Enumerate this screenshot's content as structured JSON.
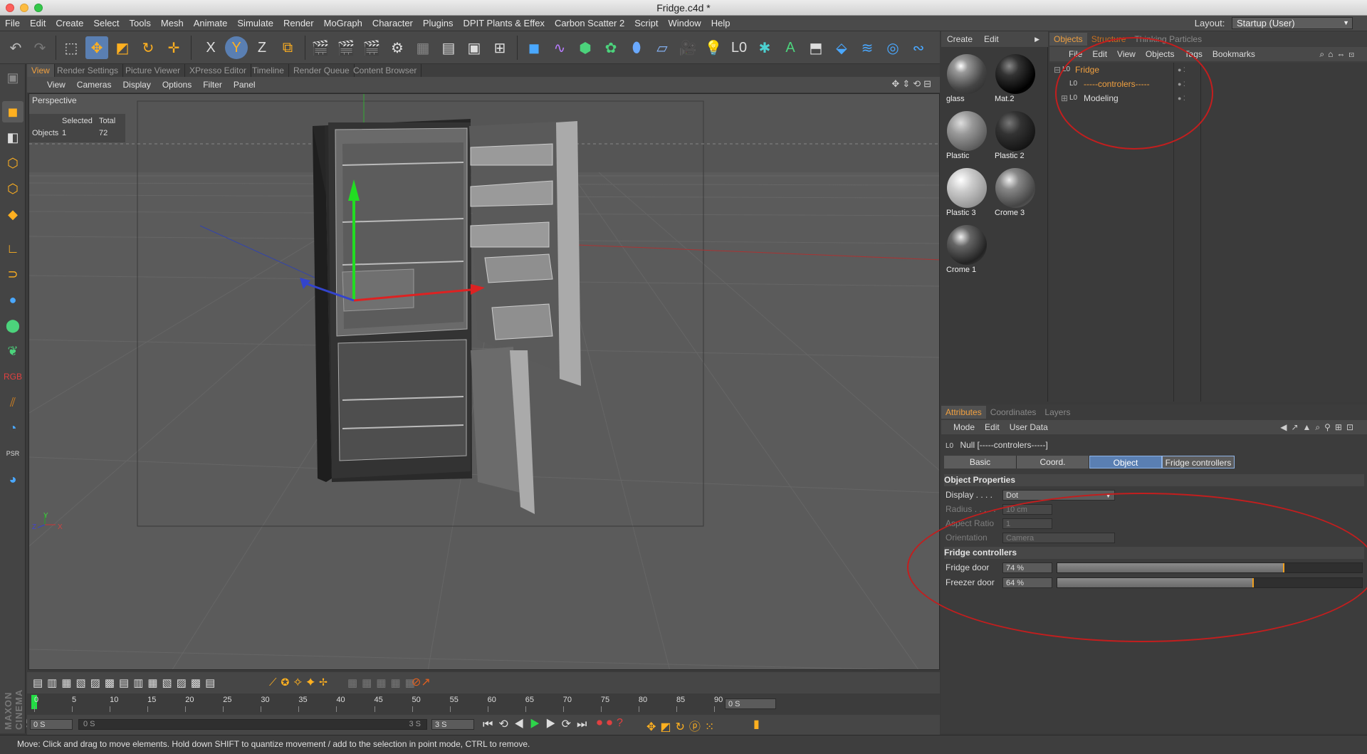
{
  "window": {
    "title": "Fridge.c4d *"
  },
  "menubar": {
    "items": [
      "File",
      "Edit",
      "Create",
      "Select",
      "Tools",
      "Mesh",
      "Animate",
      "Simulate",
      "Render",
      "MoGraph",
      "Character",
      "Plugins",
      "DPIT Plants & Effex",
      "Carbon Scatter 2",
      "Script",
      "Window",
      "Help"
    ],
    "layout_label": "Layout:",
    "layout_value": "Startup (User)"
  },
  "viewport_tabs": [
    "View",
    "Render Settings",
    "Picture Viewer",
    "XPresso Editor",
    "Timeline",
    "Render Queue",
    "Content Browser"
  ],
  "viewport_menu": [
    "View",
    "Cameras",
    "Display",
    "Options",
    "Filter",
    "Panel"
  ],
  "viewport": {
    "camera_label": "Perspective",
    "hud": {
      "col_selected": "Selected",
      "col_total": "Total",
      "row_label": "Objects",
      "selected": "1",
      "total": "72"
    },
    "axis": {
      "y": "Y",
      "z": "Z",
      "x": "X"
    }
  },
  "timeline": {
    "ticks": [
      "0",
      "5",
      "10",
      "15",
      "20",
      "25",
      "30",
      "35",
      "40",
      "45",
      "50",
      "55",
      "60",
      "65",
      "70",
      "75",
      "80",
      "85",
      "90"
    ],
    "current_frame": "0 S",
    "range_start": "0 S",
    "range_slider_start": "0 S",
    "range_slider_end": "3 S",
    "range_end": "3 S",
    "end_time": "0 S"
  },
  "status": {
    "text": "Move: Click and drag to move elements. Hold down SHIFT to quantize movement / add to the selection in point mode, CTRL to remove."
  },
  "materials": {
    "menu": [
      "Create",
      "Edit"
    ],
    "items": [
      {
        "name": "glass"
      },
      {
        "name": "Mat.2"
      },
      {
        "name": "Plastic"
      },
      {
        "name": "Plastic 2"
      },
      {
        "name": "Plastic 3"
      },
      {
        "name": "Crome 3"
      },
      {
        "name": "Crome 1"
      }
    ]
  },
  "objects": {
    "tabs": [
      "Objects",
      "Structure",
      "Thinking Particles"
    ],
    "menu": [
      "File",
      "Edit",
      "View",
      "Objects",
      "Tags",
      "Bookmarks"
    ],
    "tree": [
      {
        "name": "Fridge",
        "selected": true
      },
      {
        "name": "-----controlers-----",
        "selected": true
      },
      {
        "name": "Modeling",
        "selected": false
      }
    ]
  },
  "attributes": {
    "tabs": [
      "Attributes",
      "Coordinates",
      "Layers"
    ],
    "menu": [
      "Mode",
      "Edit",
      "User Data"
    ],
    "object_title": "Null [-----controlers-----]",
    "subtabs": [
      "Basic",
      "Coord.",
      "Object",
      "Fridge controllers"
    ],
    "object_properties": {
      "heading": "Object Properties",
      "display_label": "Display . . . .",
      "display_value": "Dot",
      "radius_label": "Radius . . . . .",
      "radius_value": "10 cm",
      "aspect_label": "Aspect Ratio",
      "aspect_value": "1",
      "orientation_label": "Orientation",
      "orientation_value": "Camera"
    },
    "fridge_controllers": {
      "heading": "Fridge controllers",
      "fridge_door_label": "Fridge door",
      "fridge_door_value": "74 %",
      "fridge_door_level": 0.74,
      "freezer_door_label": "Freezer door",
      "freezer_door_value": "64 %",
      "freezer_door_level": 0.64
    }
  },
  "branding": {
    "vertical": "MAXON CINEMA 4D"
  },
  "colors": {
    "accent_orange": "#f0a040",
    "annotation_red": "#c31e1e",
    "selected_tab_blue": "#5a7fb2"
  }
}
